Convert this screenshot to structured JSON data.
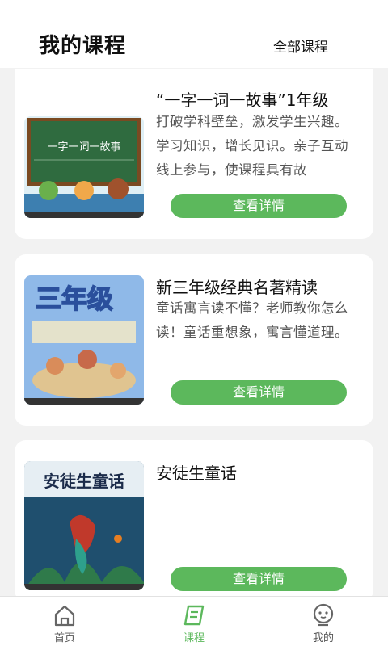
{
  "header": {
    "title": "我的课程",
    "all_courses": "全部课程"
  },
  "courses": [
    {
      "title": "“一字一词一故事”1年级",
      "desc": "打破学科壁垒，激发学生兴趣。学习知识，增长见识。亲子互动线上参与，使课程具有故",
      "button": "查看详情",
      "cover_text": "一字一词一故事"
    },
    {
      "title": "新三年级经典名著精读",
      "desc": "童话寓言读不懂？老师教你怎么读！童话重想象，寓言懂道理。",
      "button": "查看详情",
      "cover_text": "三年级"
    },
    {
      "title": "安徒生童话",
      "desc": "",
      "button": "查看详情",
      "cover_text": "安徒生童话"
    }
  ],
  "tabbar": [
    {
      "label": "首页",
      "icon": "home-icon"
    },
    {
      "label": "课程",
      "icon": "book-icon",
      "active": true
    },
    {
      "label": "我的",
      "icon": "user-icon"
    }
  ],
  "colors": {
    "accent": "#5cb85c"
  }
}
